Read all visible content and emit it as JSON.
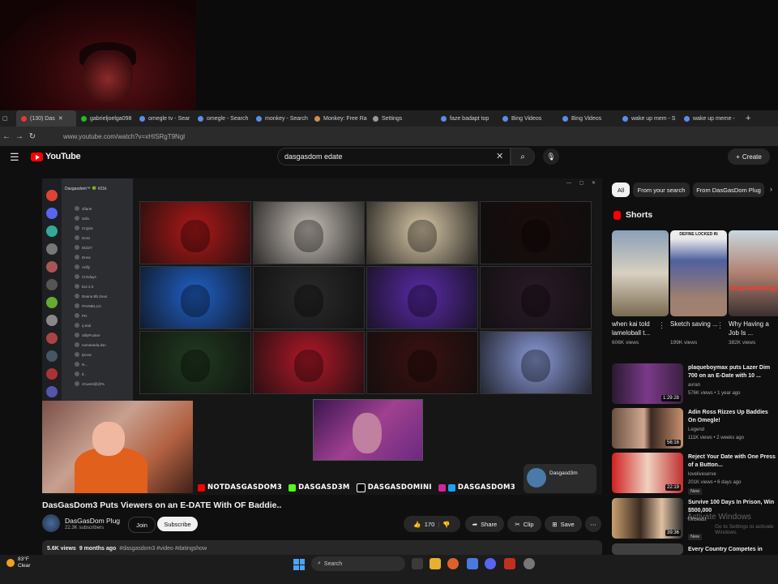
{
  "browser": {
    "tabs": [
      {
        "label": "(130) Das",
        "icon": "youtube-icon",
        "active": true
      },
      {
        "label": "gabrieljoelga098",
        "icon": "kick-icon"
      },
      {
        "label": "omegle tv - Sear",
        "icon": "bing-search-icon"
      },
      {
        "label": "omegle - Search",
        "icon": "bing-search-icon"
      },
      {
        "label": "monkey - Search",
        "icon": "bing-search-icon"
      },
      {
        "label": "Monkey: Free Ra",
        "icon": "monkey-icon"
      },
      {
        "label": "Settings",
        "icon": "gear-icon"
      },
      {
        "label": "faze badapt top",
        "icon": "bing-search-icon"
      },
      {
        "label": "Bing Videos",
        "icon": "bing-search-icon"
      },
      {
        "label": "Bing Videos",
        "icon": "bing-search-icon"
      },
      {
        "label": "wake up mem - S",
        "icon": "bing-search-icon"
      },
      {
        "label": "wake up meme -",
        "icon": "bing-search-icon"
      }
    ],
    "url": "www.youtube.com/watch?v=xHISRgT9Ngl"
  },
  "youtube": {
    "logo_text": "YouTube",
    "search_value": "dasgasdom edate",
    "create_label": "Create"
  },
  "player": {
    "discord_header": "Dasgasdom™ 🍀 #21k",
    "discord_users": [
      "4fiane",
      "ssilo",
      "Cryptic",
      "Doss",
      "DIZZY",
      "Drew",
      "Ariify",
      "CrOdays",
      "kss 2.0",
      "Deana Bb Zeus",
      "PAVMELLO",
      "PH",
      "q trial",
      "SillyPooker",
      "nomeeeda.dsn",
      "Ijsrow",
      "N...",
      "tl..",
      "JCwest@@%"
    ],
    "social_bar": [
      "NOTDASGASDOM3",
      "DASGASD3M",
      "DASGASDOMINI",
      "DASGASDOM3"
    ],
    "creator_card_name": "Dasgasd3m",
    "cell_colors": [
      "#b01818",
      "#c8c0b8",
      "#d8c8a8",
      "#1a0c0c",
      "#2060c8",
      "#2a2a2a",
      "#5a2aa8",
      "#2a1a28",
      "#203a20",
      "#b01828",
      "#3a1010",
      "#8a9ad8"
    ]
  },
  "video": {
    "title": "DasGasDom3 Puts Viewers on an E-DATE With OF Baddie..",
    "channel": "DasGasDom Plug",
    "subscribers": "22.3K subscribers",
    "join_label": "Join",
    "subscribe_label": "Subscribe",
    "likes": "170",
    "share_label": "Share",
    "clip_label": "Clip",
    "save_label": "Save",
    "views": "5.6K views",
    "age": "9 months ago",
    "tags": "#dasgasdom3 #video #datingshow"
  },
  "sidebar": {
    "chips": [
      "All",
      "From your search",
      "From DasGasDom Plug"
    ],
    "shorts_heading": "Shorts",
    "shorts": [
      {
        "title": "when kai told lameloball t...",
        "views": "606K views",
        "overlay": ""
      },
      {
        "title": "Sketch saving ...",
        "views": "199K views",
        "overlay": "DEFINE LOCKED IN"
      },
      {
        "title": "Why Having a Job Is ...",
        "views": "382K views",
        "overlay": "stop working"
      }
    ],
    "videos": [
      {
        "title": "plaqueboymax puts Lazer Dim 700 on an E-Date with 10 ...",
        "channel": "avran",
        "meta": "576K views • 1 year ago",
        "duration": "1:29:28",
        "new": ""
      },
      {
        "title": "Adin Ross Rizzes Up Baddies On Omegle!",
        "channel": "Legend",
        "meta": "111K views • 2 weeks ago",
        "duration": "56:16",
        "new": ""
      },
      {
        "title": "Reject Your Date with One Press of a Button...",
        "channel": "loveliveserve",
        "meta": "201K views • 6 days ago",
        "duration": "22:19",
        "new": "New"
      },
      {
        "title": "Survive 100 Days In Prison, Win $500,000",
        "channel": "MrBeast",
        "meta": "",
        "duration": "39:36",
        "new": "New"
      },
      {
        "title": "Every Country Competes in",
        "channel": "",
        "meta": "",
        "duration": "",
        "new": ""
      }
    ],
    "activate_title": "Activate Windows",
    "activate_sub": "Go to Settings to activate Windows."
  },
  "taskbar": {
    "temp": "83°F",
    "condition": "Clear",
    "search_placeholder": "Search"
  }
}
